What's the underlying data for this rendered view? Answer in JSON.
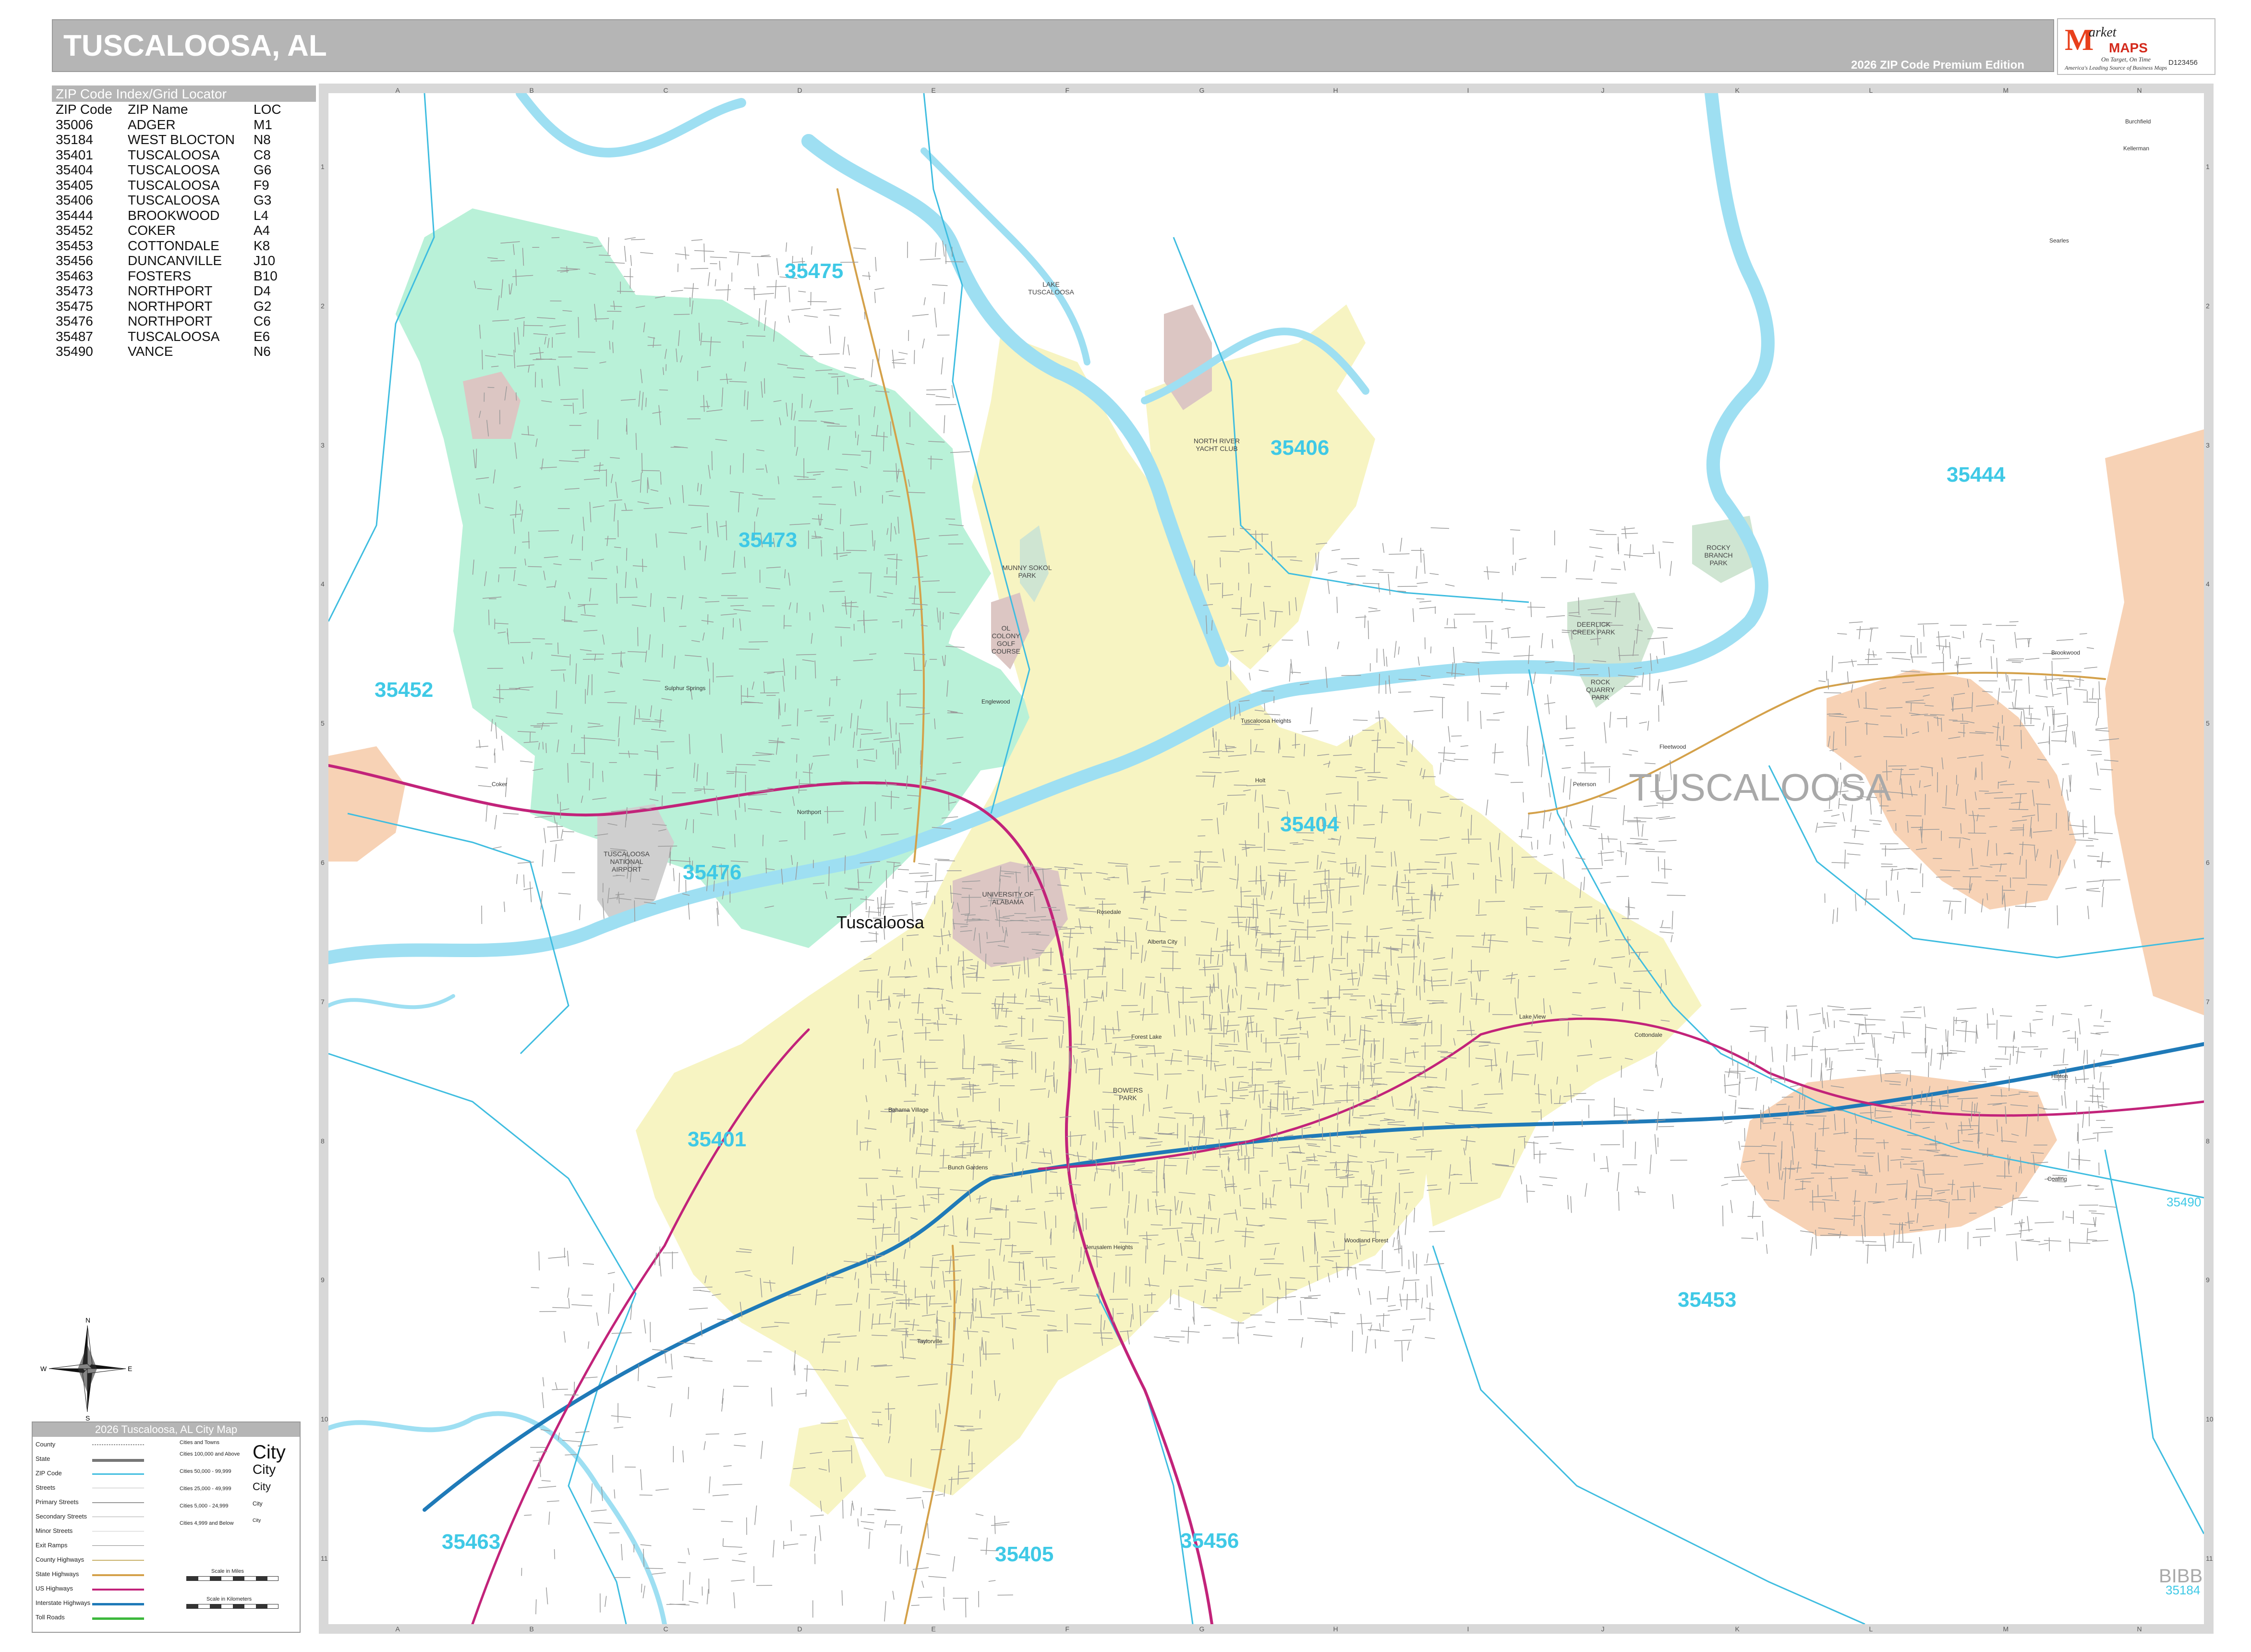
{
  "header": {
    "title": "TUSCALOOSA, AL",
    "edition": "2026 ZIP Code Premium Edition"
  },
  "logo": {
    "initial": "M",
    "market": "arket",
    "maps": "MAPS",
    "tagline1": "On Target, On Time",
    "tagline2": "America's Leading Source of Business Maps",
    "code": "D123456"
  },
  "zip_index": {
    "title": "ZIP Code Index/Grid Locator",
    "columns": [
      "ZIP Code",
      "ZIP Name",
      "LOC"
    ],
    "rows": [
      [
        "35006",
        "ADGER",
        "M1"
      ],
      [
        "35184",
        "WEST BLOCTON",
        "N8"
      ],
      [
        "35401",
        "TUSCALOOSA",
        "C8"
      ],
      [
        "35404",
        "TUSCALOOSA",
        "G6"
      ],
      [
        "35405",
        "TUSCALOOSA",
        "F9"
      ],
      [
        "35406",
        "TUSCALOOSA",
        "G3"
      ],
      [
        "35444",
        "BROOKWOOD",
        "L4"
      ],
      [
        "35452",
        "COKER",
        "A4"
      ],
      [
        "35453",
        "COTTONDALE",
        "K8"
      ],
      [
        "35456",
        "DUNCANVILLE",
        "J10"
      ],
      [
        "35463",
        "FOSTERS",
        "B10"
      ],
      [
        "35473",
        "NORTHPORT",
        "D4"
      ],
      [
        "35475",
        "NORTHPORT",
        "G2"
      ],
      [
        "35476",
        "NORTHPORT",
        "C6"
      ],
      [
        "35487",
        "TUSCALOOSA",
        "E6"
      ],
      [
        "35490",
        "VANCE",
        "N6"
      ]
    ]
  },
  "map": {
    "grid_columns": [
      "A",
      "B",
      "C",
      "D",
      "E",
      "F",
      "G",
      "H",
      "I",
      "J",
      "K",
      "L",
      "M",
      "N"
    ],
    "grid_rows": [
      "1",
      "2",
      "3",
      "4",
      "5",
      "6",
      "7",
      "8",
      "9",
      "10",
      "11"
    ],
    "county_label": "TUSCALOOSA",
    "county_corner": "BIBB",
    "main_city": "Tuscaloosa",
    "zip_labels": [
      "35475",
      "35406",
      "35444",
      "35473",
      "35452",
      "35404",
      "35476",
      "35401",
      "35453",
      "35490",
      "35463",
      "35405",
      "35456",
      "35184"
    ],
    "places": [
      "Coker",
      "Cottondale",
      "Northport",
      "Holt",
      "Fleetwood",
      "Peterson",
      "Brookwood",
      "Alberta City",
      "Forest Lake",
      "Bunch Gardens",
      "Bahama Village",
      "Woodland Forest",
      "Jerusalem Heights",
      "Taylorville",
      "Coaling",
      "Hinton",
      "Searles",
      "Kellerman",
      "Burchfield",
      "Lake View",
      "Rosedale",
      "Englewood",
      "Sulphur Springs",
      "Tuscaloosa Heights"
    ],
    "parks": [
      "TUSCALOOSA NATIONAL AIRPORT",
      "UNIVERSITY OF ALABAMA",
      "MUNNY SOKOL PARK",
      "ROCKY BRANCH PARK",
      "DEERLICK CREEK PARK",
      "ROCK QUARRY PARK",
      "BOWERS PARK",
      "NORTH RIVER YACHT CLUB",
      "LAKE TUSCALOOSA",
      "OL COLONY GOLF COURSE"
    ],
    "colors": {
      "water": "#9edff2",
      "zip_boundary": "#3fbde0",
      "zone_yellow": "#f7f4c2",
      "zone_green": "#b9f1d8",
      "zone_orange": "#f7d2b5",
      "urban_pink": "#dcc6c3",
      "park": "#cfe5d2",
      "interstate": "#1f7ab8",
      "us_highway": "#c2237a",
      "state_highway": "#d4a14a",
      "street": "#9a9a9a"
    }
  },
  "legend": {
    "title": "2026 Tuscaloosa, AL City Map",
    "rows": [
      "County",
      "State",
      "ZIP Code",
      "Streets",
      "Primary Streets",
      "Secondary Streets",
      "Minor Streets",
      "Exit Ramps",
      "County Highways",
      "State Highways",
      "US Highways",
      "Interstate Highways",
      "Toll Roads"
    ],
    "cities_header": "Cities and Towns",
    "cities": [
      {
        "range": "Cities 100,000 and Above",
        "sample": "City"
      },
      {
        "range": "Cities 50,000 - 99,999",
        "sample": "City"
      },
      {
        "range": "Cities 25,000 - 49,999",
        "sample": "City"
      },
      {
        "range": "Cities 5,000 - 24,999",
        "sample": "City"
      },
      {
        "range": "Cities 4,999 and Below",
        "sample": "City"
      }
    ],
    "scale_miles": "Scale in Miles",
    "scale_km": "Scale in Kilometers"
  },
  "compass": {
    "n": "N",
    "s": "S",
    "e": "E",
    "w": "W"
  }
}
